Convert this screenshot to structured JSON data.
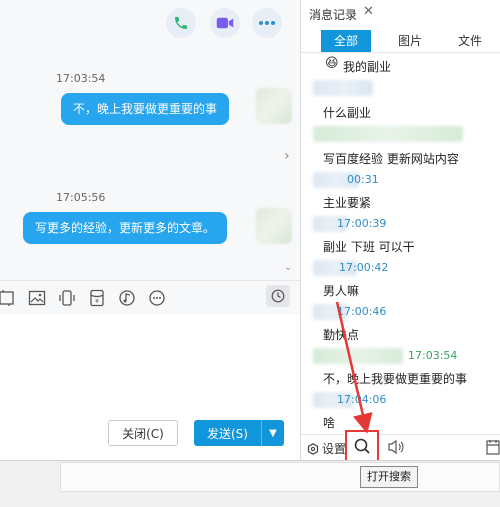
{
  "chat": {
    "messages": [
      {
        "time": "17:03:54",
        "text": "不，晚上我要做更重要的事"
      },
      {
        "time": "17:05:56",
        "text": "写更多的经验，更新更多的文章。"
      }
    ],
    "buttons": {
      "close": "关闭(C)",
      "send": "发送(S)"
    }
  },
  "history": {
    "title": "消息记录",
    "tabs": [
      "全部",
      "图片",
      "文件"
    ],
    "items": [
      {
        "text": "我的副业",
        "time": ""
      },
      {
        "text": "什么副业",
        "time": ""
      },
      {
        "text": "写百度经验  更新网站内容",
        "time": "00:31"
      },
      {
        "text": "主业要紧",
        "time": "17:00:39"
      },
      {
        "text": "副业 下班 可以干",
        "time": "17:00:42"
      },
      {
        "text": "男人嘛",
        "time": "17:00:46"
      },
      {
        "text": "勤快点",
        "time": "17:03:54"
      },
      {
        "text": "不，晚上我要做更重要的事",
        "time": "17:04:06"
      },
      {
        "text": "啥",
        "time": ""
      }
    ],
    "settings_label": "设置"
  },
  "tooltip": "打开搜索"
}
